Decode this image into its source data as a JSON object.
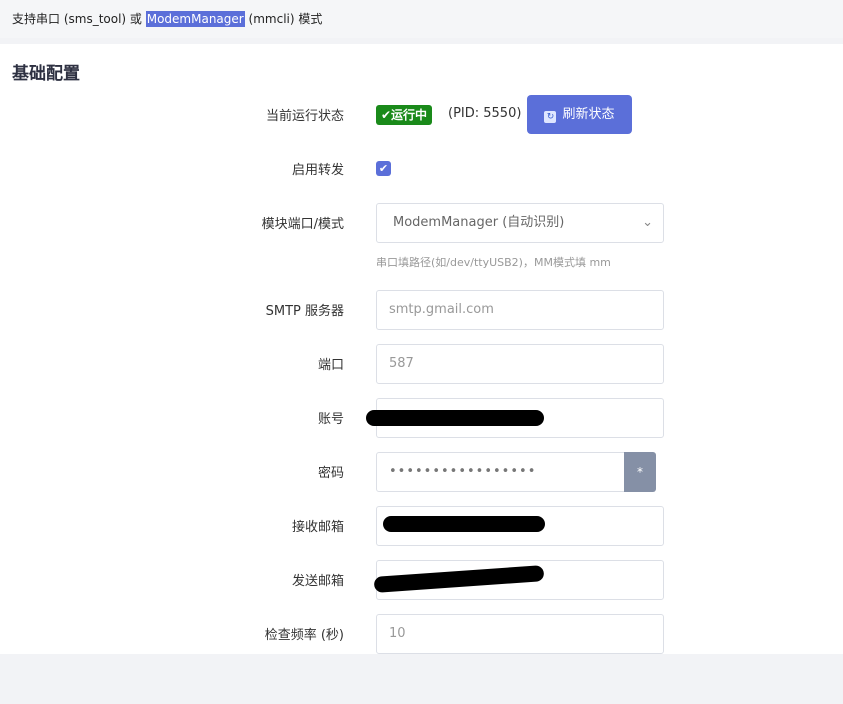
{
  "topbar": {
    "text_before": "支持串口 (sms_tool) 或 ",
    "highlight": "ModemManager",
    "text_after": " (mmcli) 模式"
  },
  "section": {
    "title": "基础配置"
  },
  "form": {
    "status": {
      "label": "当前运行状态",
      "badge": "✔运行中",
      "pid": "(PID: 5550)",
      "refresh_label": "刷新状态"
    },
    "enable": {
      "label": "启用转发",
      "checked": "✔"
    },
    "port": {
      "label": "模块端口/模式",
      "value": "ModemManager (自动识别)",
      "hint": "串口填路径(如/dev/ttyUSB2)，MM模式填 mm"
    },
    "smtp": {
      "label": "SMTP 服务器",
      "placeholder": "smtp.gmail.com"
    },
    "smtp_port": {
      "label": "端口",
      "placeholder": "587"
    },
    "account": {
      "label": "账号"
    },
    "password": {
      "label": "密码",
      "value": "•••••••••••••••••",
      "reveal": "*"
    },
    "receiver": {
      "label": "接收邮箱"
    },
    "sender": {
      "label": "发送邮箱"
    },
    "interval": {
      "label": "检查频率 (秒)",
      "placeholder": "10"
    }
  },
  "colors": {
    "accent": "#5b6fd9",
    "status_green": "#1a8a1a",
    "reveal_button": "#8590a6"
  }
}
